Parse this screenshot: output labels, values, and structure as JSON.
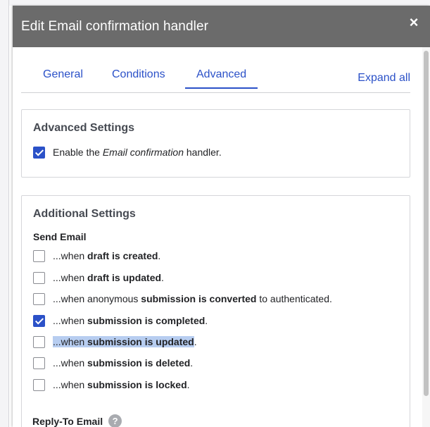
{
  "dialog": {
    "title": "Edit Email confirmation handler",
    "close_glyph": "×"
  },
  "tabs": [
    {
      "label": "General",
      "active": false
    },
    {
      "label": "Conditions",
      "active": false
    },
    {
      "label": "Advanced",
      "active": true
    }
  ],
  "expand_all_label": "Expand all",
  "advanced_settings": {
    "title": "Advanced Settings",
    "enable": {
      "checked": true,
      "prefix": "Enable the ",
      "emph": "Email confirmation",
      "suffix": " handler."
    }
  },
  "additional_settings": {
    "title": "Additional Settings",
    "send_email_label": "Send Email",
    "options": [
      {
        "checked": false,
        "pre": "...when ",
        "bold": "draft is created",
        "post": "."
      },
      {
        "checked": false,
        "pre": "...when ",
        "bold": "draft is updated",
        "post": "."
      },
      {
        "checked": false,
        "pre": "...when anonymous ",
        "bold": "submission is converted",
        "post": " to authenticated."
      },
      {
        "checked": true,
        "pre": "...when ",
        "bold": "submission is completed",
        "post": "."
      },
      {
        "checked": false,
        "pre": "...when ",
        "bold": "submission is updated",
        "post": "."
      },
      {
        "checked": false,
        "pre": "...when ",
        "bold": "submission is deleted",
        "post": "."
      },
      {
        "checked": false,
        "pre": "...when ",
        "bold": "submission is locked",
        "post": "."
      }
    ],
    "reply_to_label": "Reply-To Email",
    "help_glyph": "?"
  },
  "icons": {
    "close": "close-icon",
    "help": "question-mark-icon",
    "checkbox_checked": "checkmark-icon"
  },
  "colors": {
    "titlebar": "#6b6b6b",
    "accent": "#2b51c8",
    "selection_highlight": "#b7cdf0"
  }
}
